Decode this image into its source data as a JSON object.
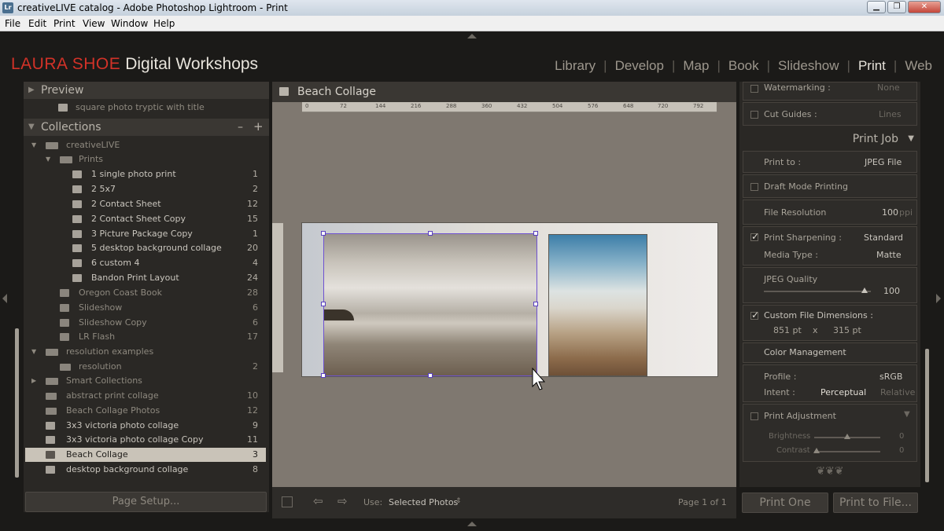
{
  "window": {
    "app_icon": "Lr",
    "title": "creativeLIVE catalog - Adobe Photoshop Lightroom - Print",
    "minimize": "▁",
    "restore": "❐",
    "close": "✕"
  },
  "menu": [
    "File",
    "Edit",
    "Print",
    "View",
    "Window",
    "Help"
  ],
  "identity": {
    "brand": "LAURA SHOE",
    "tagline": "Digital Workshops"
  },
  "modules": [
    "Library",
    "Develop",
    "Map",
    "Book",
    "Slideshow",
    "Print",
    "Web"
  ],
  "active_module": "Print",
  "left": {
    "preview_header": "Preview",
    "template_item": "square photo tryptic with title",
    "collections_header": "Collections",
    "collections_minus": "–",
    "collections_plus": "+",
    "items": [
      {
        "label": "creativeLIVE",
        "count": ""
      },
      {
        "label": "Prints",
        "count": ""
      },
      {
        "label": "1 single photo print",
        "count": "1"
      },
      {
        "label": "2 5x7",
        "count": "2"
      },
      {
        "label": "2 Contact Sheet",
        "count": "12"
      },
      {
        "label": "2 Contact Sheet Copy",
        "count": "15"
      },
      {
        "label": "3 Picture Package Copy",
        "count": "1"
      },
      {
        "label": "5 desktop background collage",
        "count": "20"
      },
      {
        "label": "6 custom 4",
        "count": "4"
      },
      {
        "label": "Bandon Print Layout",
        "count": "24"
      },
      {
        "label": "Oregon Coast Book",
        "count": "28"
      },
      {
        "label": "Slideshow",
        "count": "6"
      },
      {
        "label": "Slideshow Copy",
        "count": "6"
      },
      {
        "label": "LR Flash",
        "count": "17"
      },
      {
        "label": "resolution examples",
        "count": ""
      },
      {
        "label": "resolution",
        "count": "2"
      },
      {
        "label": "Smart Collections",
        "count": ""
      },
      {
        "label": "abstract print collage",
        "count": "10"
      },
      {
        "label": "Beach Collage Photos",
        "count": "12"
      },
      {
        "label": "3x3 victoria photo collage",
        "count": "9"
      },
      {
        "label": "3x3 victoria photo collage Copy",
        "count": "11"
      },
      {
        "label": "Beach Collage",
        "count": "3"
      },
      {
        "label": "desktop background collage",
        "count": "8"
      }
    ],
    "page_setup": "Page Setup..."
  },
  "center": {
    "title": "Beach Collage",
    "ruler_ticks": [
      "0",
      "72",
      "144",
      "216",
      "288",
      "360",
      "432",
      "504",
      "576",
      "648",
      "720",
      "792"
    ],
    "use_label": "Use:",
    "use_value": "Selected Photos",
    "page_info": "Page 1 of 1"
  },
  "right": {
    "watermarking_label": "Watermarking :",
    "watermarking_value": "None",
    "cut_guides_label": "Cut Guides :",
    "cut_guides_value": "Lines",
    "print_job_header": "Print Job",
    "print_to_label": "Print to :",
    "print_to_value": "JPEG File",
    "draft_mode": "Draft Mode Printing",
    "file_resolution_label": "File Resolution",
    "file_resolution_value": "100",
    "file_resolution_unit": "ppi",
    "print_sharpening_label": "Print Sharpening :",
    "print_sharpening_value": "Standard",
    "media_type_label": "Media Type :",
    "media_type_value": "Matte",
    "jpeg_quality_label": "JPEG Quality",
    "jpeg_quality_value": "100",
    "custom_dims_label": "Custom File Dimensions :",
    "custom_width": "851 pt",
    "custom_x": "x",
    "custom_height": "315 pt",
    "color_mgmt": "Color Management",
    "profile_label": "Profile :",
    "profile_value": "sRGB",
    "intent_label": "Intent :",
    "intent_perceptual": "Perceptual",
    "intent_relative": "Relative",
    "print_adjustment": "Print Adjustment",
    "brightness_label": "Brightness",
    "brightness_value": "0",
    "contrast_label": "Contrast",
    "contrast_value": "0",
    "print_one": "Print One",
    "print_to_file": "Print to File..."
  },
  "levels": {
    "jpeg_quality_fraction": 1.0,
    "brightness_fraction": 0.5,
    "contrast_fraction": 0.0
  },
  "colors": {
    "brand_red": "#d23228",
    "selection": "#6f52d0",
    "selected_row": "#c9c3b8"
  }
}
